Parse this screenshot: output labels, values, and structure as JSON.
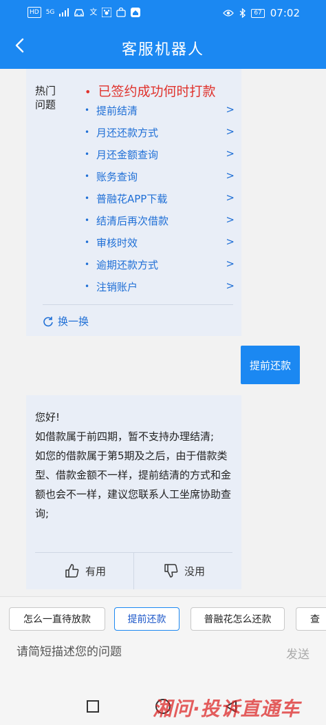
{
  "status_bar": {
    "left_icons": [
      "HD",
      "5G",
      "signal-icon",
      "car-icon",
      "translate-icon",
      "paw-icon",
      "bag-icon",
      "home-icon"
    ],
    "network": "5G",
    "hd": "HD",
    "battery": "67",
    "time": "07:02"
  },
  "header": {
    "title": "客服机器人"
  },
  "hot_questions": {
    "label": "热门\n问题",
    "first_item": "已签约成功何时打款",
    "items": [
      {
        "label": "提前结清",
        "arrow": ">"
      },
      {
        "label": "月还还款方式",
        "arrow": ">"
      },
      {
        "label": "月还金额查询",
        "arrow": ">"
      },
      {
        "label": "账务查询",
        "arrow": ">"
      },
      {
        "label": "普融花APP下载",
        "arrow": ">"
      },
      {
        "label": "结清后再次借款",
        "arrow": ">"
      },
      {
        "label": "审核时效",
        "arrow": ">"
      },
      {
        "label": "逾期还款方式",
        "arrow": ">"
      },
      {
        "label": "注销账户",
        "arrow": ">"
      }
    ],
    "refresh_label": "换一换"
  },
  "user_message": "提前还款",
  "bot_reply": {
    "lines": [
      "您好!",
      "如借款属于前四期，暂不支持办理结清;",
      "如您的借款属于第5期及之后，由于借款类型、借款金额不一样，提前结清的方式和金额也会不一样，建议您联系人工坐席协助查询;"
    ],
    "useful_label": "有用",
    "useless_label": "没用"
  },
  "quick_replies": [
    {
      "label": "怎么一直待放款",
      "active": false
    },
    {
      "label": "提前还款",
      "active": true
    },
    {
      "label": "普融花怎么还款",
      "active": false
    },
    {
      "label": "查",
      "active": false
    }
  ],
  "input": {
    "placeholder": "请简短描述您的问题",
    "send_label": "发送"
  },
  "watermark": "湘问·投诉直通车",
  "colors": {
    "brand": "#1b88f2",
    "highlight": "#e0322c",
    "link": "#1f6fd6"
  }
}
